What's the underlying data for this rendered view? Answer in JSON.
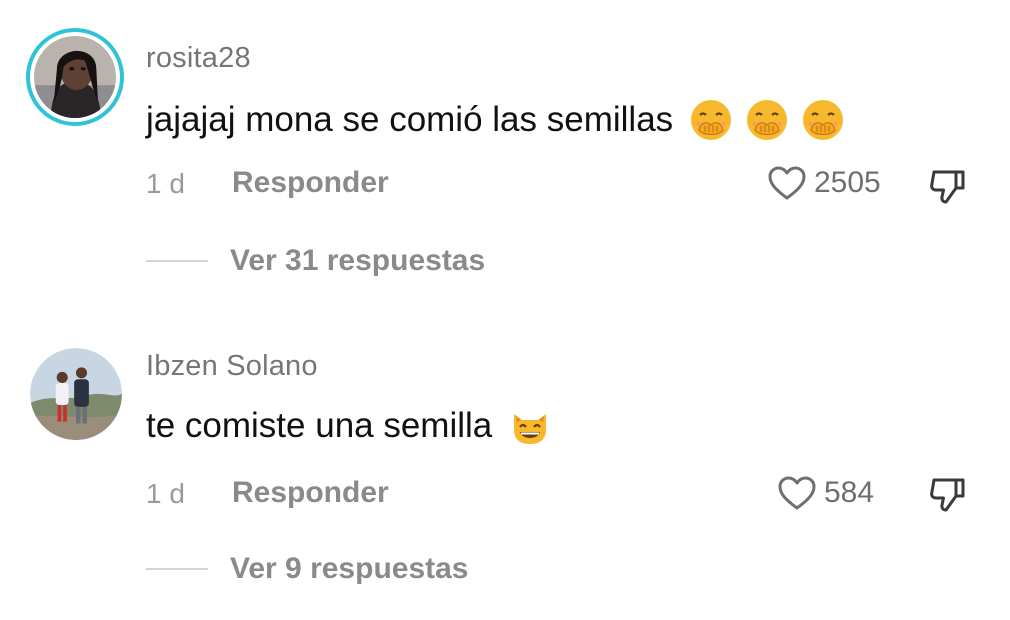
{
  "comments": [
    {
      "username": "rosita28",
      "text": "jajajaj mona se comió las semillas",
      "emoji_icons": [
        "hand-over-mouth-emoji",
        "hand-over-mouth-emoji",
        "hand-over-mouth-emoji"
      ],
      "time": "1 d",
      "reply_label": "Responder",
      "likes": "2505",
      "view_replies": "Ver 31 respuestas",
      "avatar_has_story_ring": true
    },
    {
      "username": "Ibzen Solano",
      "text": "te comiste una semilla",
      "emoji_icons": [
        "grinning-cat-emoji"
      ],
      "time": "1 d",
      "reply_label": "Responder",
      "likes": "584",
      "view_replies": "Ver 9 respuestas",
      "avatar_has_story_ring": false
    }
  ],
  "colors": {
    "story_ring": "#2ec4d6",
    "username": "#767676",
    "meta": "#8a8a8a"
  }
}
